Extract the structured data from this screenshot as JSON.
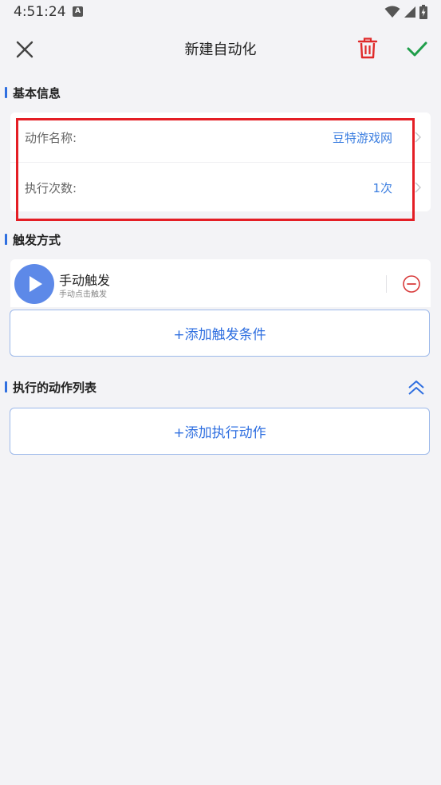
{
  "status_bar": {
    "time": "4:51:24",
    "notification_icon": "a-icon",
    "icons": [
      "wifi-icon",
      "signal-icon",
      "battery-charging-icon"
    ]
  },
  "app_bar": {
    "title": "新建自动化",
    "close_icon": "close-icon",
    "delete_icon": "trash-icon",
    "confirm_icon": "check-icon"
  },
  "colors": {
    "accent": "#2f6fe0",
    "link_value": "#3a7de0",
    "delete": "#e02a2a",
    "confirm": "#1f9e4a",
    "highlight": "#e41e25",
    "background": "#f3f3f6"
  },
  "basic_info": {
    "header": "基本信息",
    "rows": [
      {
        "label": "动作名称:",
        "value": "豆特游戏网"
      },
      {
        "label": "执行次数:",
        "value": "1次"
      }
    ]
  },
  "trigger": {
    "header": "触发方式",
    "item": {
      "icon": "play-icon",
      "title": "手动触发",
      "subtitle": "手动点击触发",
      "remove_icon": "minus-circle-icon"
    },
    "add_label": "+添加触发条件"
  },
  "actions": {
    "header": "执行的动作列表",
    "collapse_icon": "double-chevron-up-icon",
    "add_label": "+添加执行动作"
  }
}
